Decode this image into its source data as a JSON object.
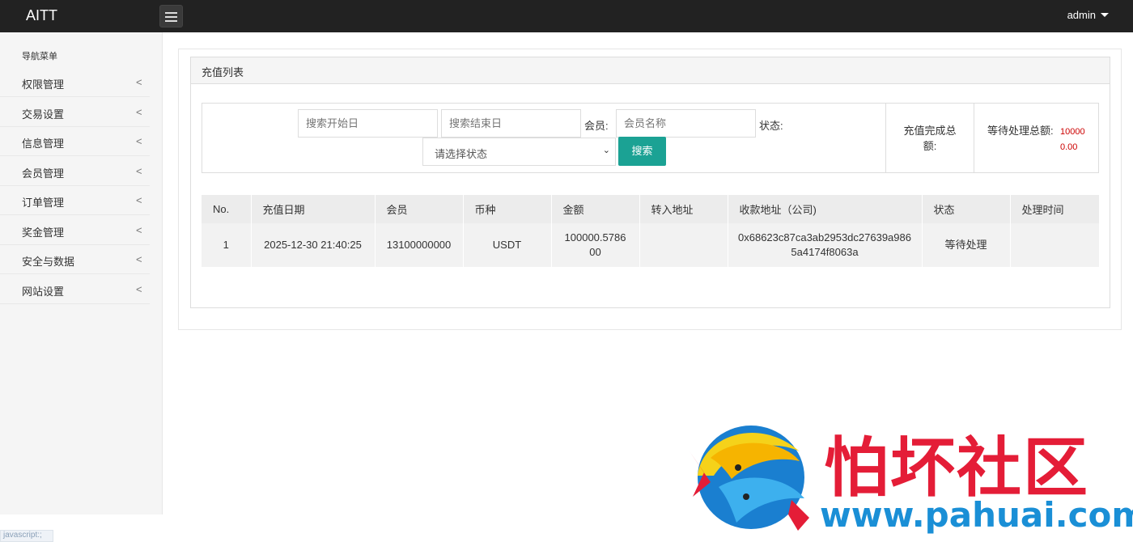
{
  "app": {
    "brand": "AITT",
    "user": "admin"
  },
  "sidebar": {
    "title": "导航菜单",
    "items": [
      {
        "label": "权限管理"
      },
      {
        "label": "交易设置"
      },
      {
        "label": "信息管理"
      },
      {
        "label": "会员管理"
      },
      {
        "label": "订单管理"
      },
      {
        "label": "奖金管理"
      },
      {
        "label": "安全与数据"
      },
      {
        "label": "网站设置"
      }
    ],
    "chevron": "<"
  },
  "panel": {
    "title": "充值列表"
  },
  "search": {
    "start_placeholder": "搜索开始日",
    "end_placeholder": "搜索结束日",
    "member_label": "会员:",
    "member_placeholder": "会员名称",
    "status_label": "状态:",
    "status_select": "请选择状态",
    "search_button": "搜索"
  },
  "summary": {
    "completed_label": "充值完成总额:",
    "pending_label": "等待处理总额:",
    "pending_value": "100000.00"
  },
  "table": {
    "headers": [
      "No.",
      "充值日期",
      "会员",
      "币种",
      "金额",
      "转入地址",
      "收款地址（公司)",
      "状态",
      "处理时间"
    ],
    "rows": [
      [
        "1",
        "2025-12-30 21:40:25",
        "13100000000",
        "USDT",
        "100000.578600",
        "",
        "0x68623c87ca3ab2953dc27639a9865a4174f8063a",
        "等待处理",
        ""
      ]
    ]
  },
  "status_bar": "javascript:;",
  "watermark": {
    "name": "怕坏社区",
    "url": "www.pahuai.com"
  },
  "colors": {
    "accent": "#1ba294",
    "topbar": "#222222",
    "pending_value": "#cc0000"
  }
}
